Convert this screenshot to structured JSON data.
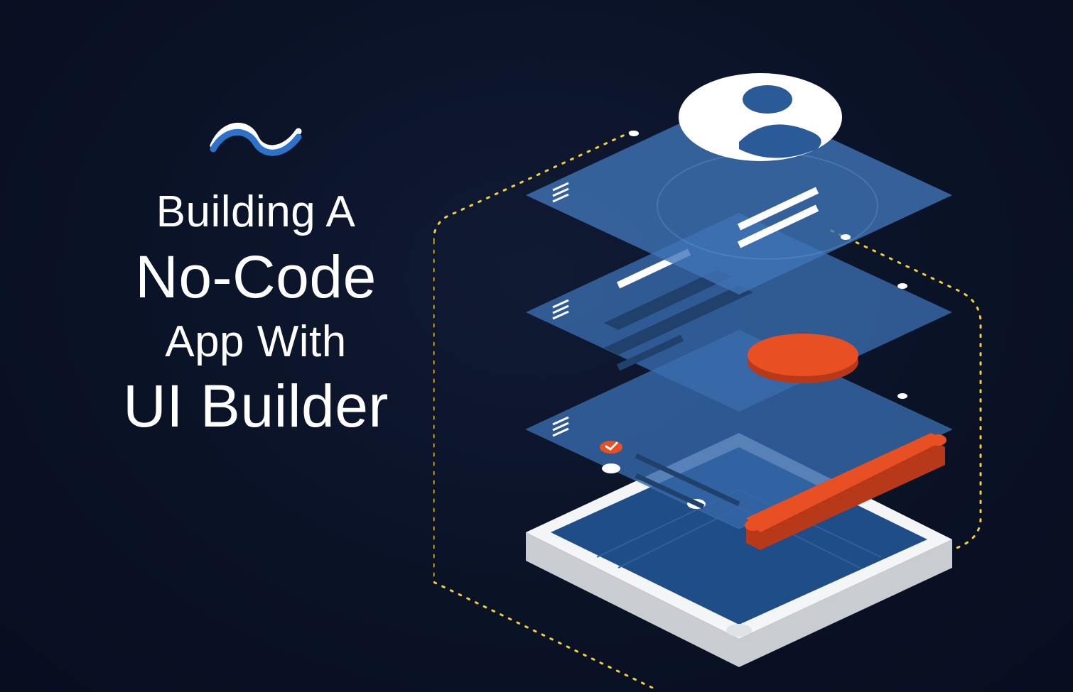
{
  "hero": {
    "line1": "Building A",
    "line2": "No-Code",
    "line3": "App With",
    "line4": "UI Builder"
  },
  "logo": {
    "name": "backendless-swoosh-logo"
  },
  "colors": {
    "accent": "#e84f23",
    "panel": "#2a5a98",
    "panel_light": "#3b6fb2",
    "bg": "#0a1226",
    "white": "#ffffff",
    "dots": "#f2cf3a"
  }
}
